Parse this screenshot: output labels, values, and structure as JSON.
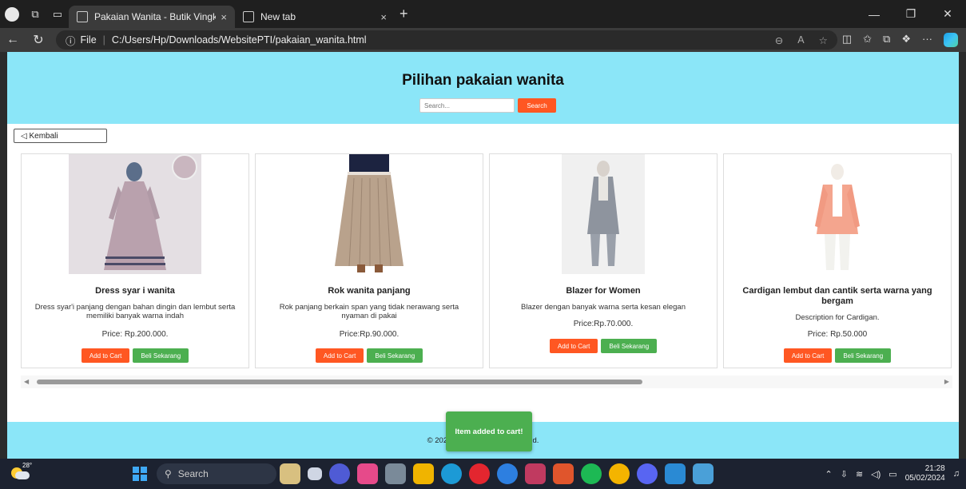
{
  "browser": {
    "tabs": [
      {
        "label": "Pakaian Wanita - Butik Vingky",
        "close": "×"
      },
      {
        "label": "New tab",
        "close": "×"
      }
    ],
    "new_tab": "+",
    "address_prefix": "File",
    "address": "C:/Users/Hp/Downloads/WebsitePTI/pakaian_wanita.html",
    "more": "···"
  },
  "page": {
    "title": "Pilihan pakaian wanita",
    "search": {
      "placeholder": "Search...",
      "button": "Search"
    },
    "back_label": "◁ Kembali",
    "products": [
      {
        "name": "Dress syar i wanita",
        "description": "Dress syar'i panjang dengan bahan dingin dan lembut serta memiliki banyak warna indah",
        "price": "Price: Rp.200.000.",
        "add_to_cart": "Add to Cart",
        "buy_now": "Beli Sekarang"
      },
      {
        "name": "Rok wanita panjang",
        "description": "Rok panjang berkain span yang tidak nerawang serta nyaman di pakai",
        "price": "Price:Rp.90.000.",
        "add_to_cart": "Add to Cart",
        "buy_now": "Beli Sekarang"
      },
      {
        "name": "Blazer for Women",
        "description": "Blazer dengan banyak warna serta kesan elegan",
        "price": "Price:Rp.70.000.",
        "add_to_cart": "Add to Cart",
        "buy_now": "Beli Sekarang"
      },
      {
        "name": "Cardigan lembut dan cantik serta warna yang bergam",
        "description": "Description for Cardigan.",
        "price": "Price: Rp.50.000",
        "add_to_cart": "Add to Cart",
        "buy_now": "Beli Sekarang"
      }
    ],
    "footer_left": "© 202",
    "footer_right": "s reserved.",
    "toast": "Item added to cart!"
  },
  "taskbar": {
    "temperature": "28°",
    "search": "Search",
    "time": "21:28",
    "date": "05/02/2024"
  },
  "colors": {
    "header_bg": "#8be6f8",
    "accent_orange": "#ff5722",
    "accent_green": "#4caf50"
  }
}
